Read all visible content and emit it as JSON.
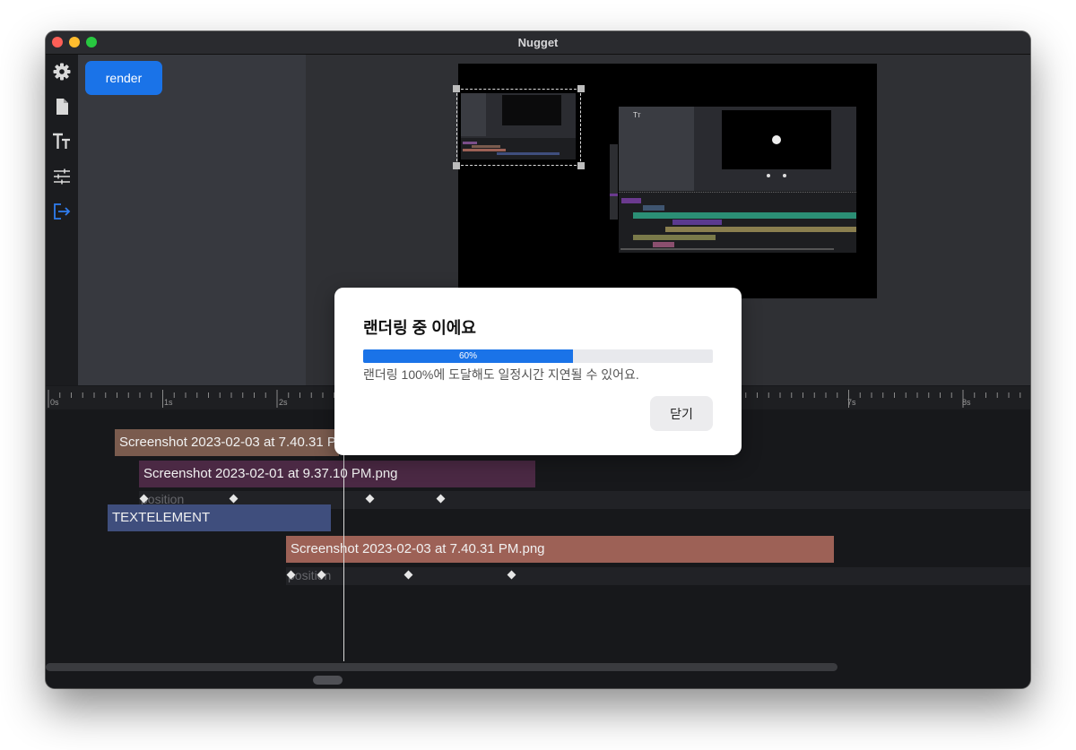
{
  "window": {
    "title": "Nugget"
  },
  "sidebar": {
    "icons": [
      {
        "name": "gear-icon"
      },
      {
        "name": "file-icon"
      },
      {
        "name": "text-icon"
      },
      {
        "name": "sliders-icon"
      },
      {
        "name": "export-icon",
        "active": true
      }
    ]
  },
  "panel": {
    "render_label": "render"
  },
  "ruler": {
    "labels": [
      "0s",
      "1s",
      "2s",
      "7s",
      "8s"
    ]
  },
  "timeline": {
    "clips": [
      {
        "label": "Screenshot 2023-02-03 at 7.40.31 PM.png",
        "color": "#7a5b4e"
      },
      {
        "label": "Screenshot 2023-02-01 at 9.37.10 PM.png",
        "color": "#4b2944"
      },
      {
        "label": "TEXTELEMENT",
        "color": "#3f4e7d"
      },
      {
        "label": "Screenshot 2023-02-03 at 7.40.31 PM.png",
        "color": "#9d6156"
      }
    ],
    "keyframe_label": "position"
  },
  "modal": {
    "title": "랜더링 중 이에요",
    "progress": 60,
    "progress_label": "60%",
    "note": "랜더링 100%에 도달해도 일정시간 지연될 수 있어요.",
    "close_label": "닫기"
  },
  "colors": {
    "accent": "#1a73e8",
    "title_bar": "#2a2b2f",
    "panel": "#37393f",
    "preview_bg": "#2f3034",
    "timeline_bg": "#17181b"
  }
}
